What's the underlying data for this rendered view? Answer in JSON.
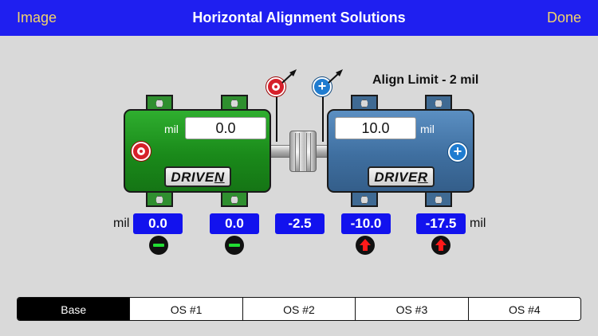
{
  "nav": {
    "left_label": "Image",
    "title": "Horizontal Alignment Solutions",
    "right_label": "Done"
  },
  "align_limit": "Align Limit - 2 mil",
  "driven": {
    "unit": "mil",
    "value": "0.0",
    "name_prefix": "DRIVE",
    "name_underlined": "N"
  },
  "driver": {
    "unit": "mil",
    "value": "10.0",
    "name_prefix": "DRIVE",
    "name_underlined": "R"
  },
  "plus_label": "+",
  "values": [
    "0.0",
    "0.0",
    "-2.5",
    "-10.0",
    "-17.5"
  ],
  "units": {
    "left": "mil",
    "right": "mil"
  },
  "indicators": [
    {
      "icon": "minus-ok-icon",
      "color": "#22dd33"
    },
    {
      "icon": "minus-ok-icon",
      "color": "#22dd33"
    },
    {
      "icon": "arrow-up-icon",
      "color": "#ff1a1a"
    },
    {
      "icon": "arrow-up-icon",
      "color": "#ff1a1a"
    }
  ],
  "tabs": [
    "Base",
    "OS #1",
    "OS #2",
    "OS #3",
    "OS #4"
  ],
  "active_tab": "Base",
  "colors": {
    "nav_bg": "#1f1ff0",
    "nav_button": "#f2d36b",
    "value_box": "#1212ee",
    "driven": "#1a8a1a",
    "driver": "#3f6fa0"
  }
}
